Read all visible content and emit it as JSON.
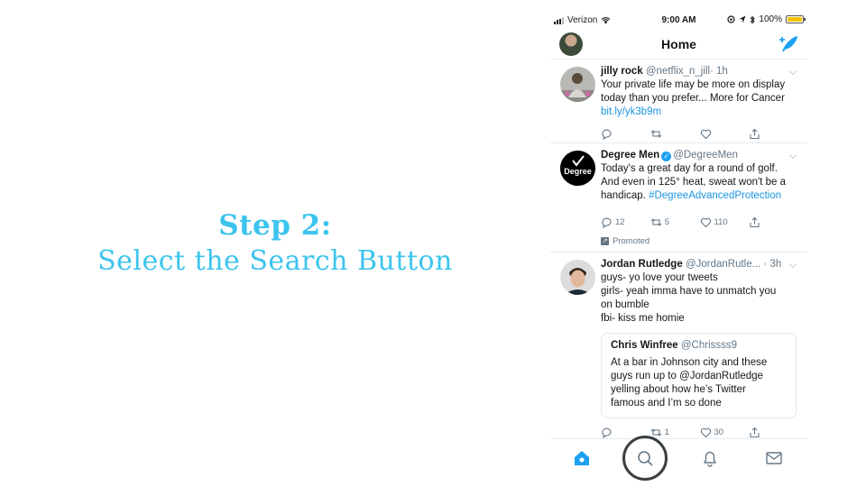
{
  "instruction": {
    "title": "Step 2:",
    "subtitle": "Select the Search Button"
  },
  "status_bar": {
    "carrier": "Verizon",
    "time": "9:00 AM",
    "battery": "100%"
  },
  "nav": {
    "title": "Home"
  },
  "tweets": [
    {
      "name": "jilly rock",
      "handle": "@netflix_n_jill",
      "time": "· 1h",
      "lines": [
        "Your private life may be more on display",
        "today than you prefer... More for Cancer"
      ],
      "link": "bit.ly/yk3b9m",
      "replies": "",
      "retweets": "",
      "likes": ""
    },
    {
      "name": "Degree Men",
      "handle": "@DegreeMen",
      "avatar_text": "Degree",
      "lines": [
        "Today's a great day for a round of golf.",
        "And even in 125° heat, sweat won't be a"
      ],
      "last_line_text": "handicap.",
      "hashtag": "#DegreeAdvancedProtection",
      "replies": "12",
      "retweets": "5",
      "likes": "110",
      "promoted": "Promoted"
    },
    {
      "name": "Jordan Rutledge",
      "handle": "@JordanRutle...",
      "time": "· 3h",
      "lines": [
        "guys- yo love your tweets",
        "girls- yeah imma have to unmatch you",
        "on bumble",
        "fbi- kiss me homie"
      ],
      "quote": {
        "name": "Chris Winfree",
        "handle": "@Chrissss9",
        "lines": [
          "At a bar in Johnson city and these",
          "guys run up to @JordanRutledge",
          "yelling about how he’s Twitter",
          "famous and I’m so done"
        ]
      },
      "replies": "",
      "retweets": "1",
      "likes": "30"
    }
  ],
  "tab_bar": {
    "tabs": [
      "home-icon",
      "search-icon",
      "bell-icon",
      "mail-icon"
    ],
    "active": "home-icon",
    "highlighted": "search-icon"
  },
  "colors": {
    "accent": "#1da1f2",
    "instruction": "#3cc4ee",
    "ring": "#3a3f42"
  }
}
